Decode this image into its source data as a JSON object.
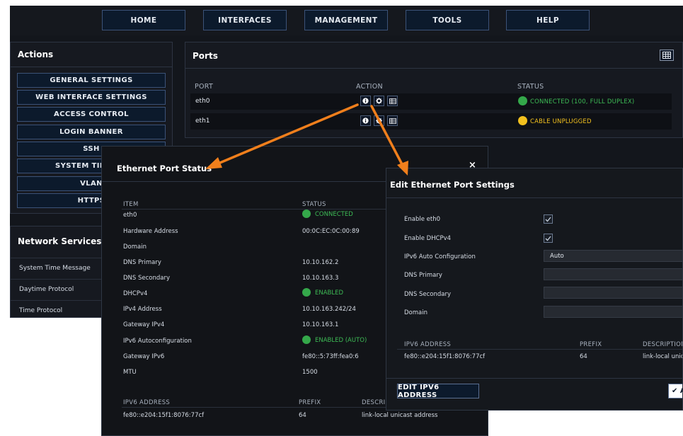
{
  "topnav": {
    "items": [
      "HOME",
      "INTERFACES",
      "MANAGEMENT",
      "TOOLS",
      "HELP"
    ]
  },
  "actions": {
    "title": "Actions",
    "buttons": [
      "GENERAL SETTINGS",
      "WEB INTERFACE SETTINGS",
      "ACCESS CONTROL",
      "LOGIN BANNER",
      "SSH",
      "SYSTEM TIME ME",
      "VLAN",
      "HTTPS"
    ]
  },
  "network_services": {
    "title": "Network Services",
    "items": [
      "System Time Message",
      "Daytime Protocol",
      "Time Protocol"
    ]
  },
  "ports": {
    "title": "Ports",
    "columns": {
      "port": "PORT",
      "action": "ACTION",
      "status": "STATUS"
    },
    "rows": [
      {
        "name": "eth0",
        "status": "CONNECTED (100, FULL DUPLEX)",
        "status_color": "#34a84a"
      },
      {
        "name": "eth1",
        "status": "CABLE UNPLUGGED",
        "status_color": "#f2c01e"
      }
    ],
    "icons": [
      "info-icon",
      "gear-icon",
      "table-icon"
    ]
  },
  "status_modal": {
    "title": "Ethernet Port Status",
    "close": "×",
    "columns": {
      "item": "ITEM",
      "status": "STATUS"
    },
    "rows": [
      {
        "item": "eth0",
        "value": "CONNECTED",
        "indicator": true
      },
      {
        "item": "Hardware Address",
        "value": "00:0C:EC:0C:00:89"
      },
      {
        "item": "Domain",
        "value": ""
      },
      {
        "item": "DNS Primary",
        "value": "10.10.162.2"
      },
      {
        "item": "DNS Secondary",
        "value": "10.10.163.3"
      },
      {
        "item": "DHCPv4",
        "value": "ENABLED",
        "indicator": true
      },
      {
        "item": "IPv4 Address",
        "value": "10.10.163.242/24"
      },
      {
        "item": "Gateway IPv4",
        "value": "10.10.163.1"
      },
      {
        "item": "IPv6 Autoconfiguration",
        "value": "ENABLED (AUTO)",
        "indicator": true
      },
      {
        "item": "Gateway IPv6",
        "value": "fe80::5:73ff:fea0:6"
      },
      {
        "item": "MTU",
        "value": "1500"
      }
    ],
    "ipv6_columns": {
      "address": "IPV6 ADDRESS",
      "prefix": "PREFIX",
      "description": "DESCRIPT"
    },
    "ipv6_rows": [
      {
        "address": "fe80::e204:15f1:8076:77cf",
        "prefix": "64",
        "description": "link-local unicast address"
      }
    ]
  },
  "edit_modal": {
    "title": "Edit Ethernet Port Settings",
    "enable_eth0_label": "Enable eth0",
    "enable_dhcpv4_label": "Enable DHCPv4",
    "ipv6_auto_label": "IPv6 Auto Configuration",
    "ipv6_auto_value": "Auto",
    "dns_primary_label": "DNS Primary",
    "dns_primary_value": "",
    "dns_secondary_label": "DNS Secondary",
    "dns_secondary_value": "",
    "domain_label": "Domain",
    "domain_value": "",
    "ipv6_columns": {
      "address": "IPV6 ADDRESS",
      "prefix": "PREFIX",
      "description": "DESCRIPTION"
    },
    "ipv6_rows": [
      {
        "address": "fe80::e204:15f1:8076:77cf",
        "prefix": "64",
        "description": "link-local unicast"
      }
    ],
    "edit_ipv6_button": "EDIT IPV6 ADDRESS",
    "ok_button": "✔ A"
  },
  "colors": {
    "accent_arrow": "#f07f1c",
    "connected_green": "#34a84a",
    "unplugged_yellow": "#f2c01e"
  }
}
